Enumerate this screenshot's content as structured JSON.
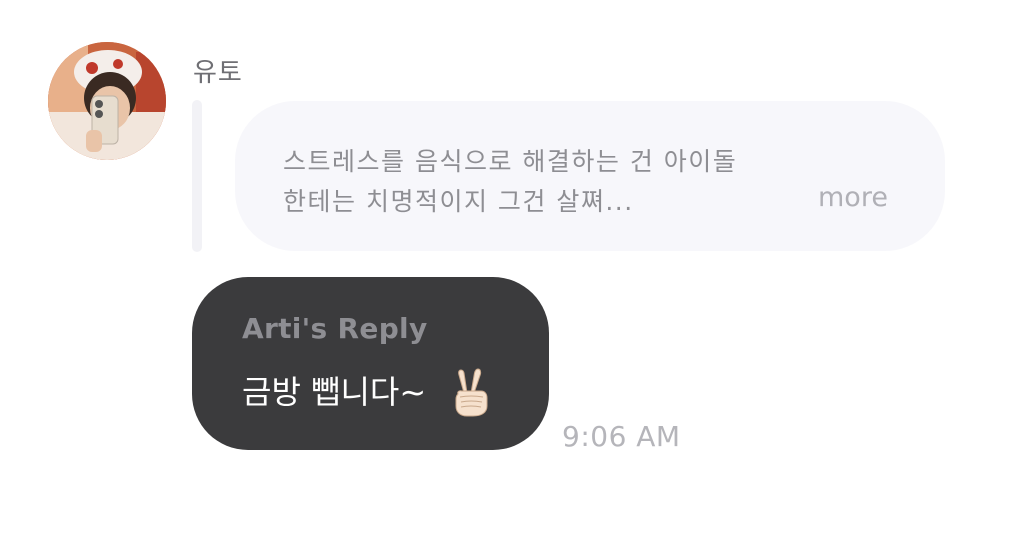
{
  "message": {
    "sender_name": "유토",
    "avatar_icon": "profile-photo",
    "quoted": {
      "line1": "스트레스를 음식으로 해결하는 건 아이돌",
      "line2": "한테는 치명적이지 그건 살쪄...",
      "more_label": "more"
    },
    "reply": {
      "title": "Arti's Reply",
      "text": "금방 뺍니다~",
      "emoji": "✌🏻"
    },
    "timestamp": "9:06 AM"
  },
  "colors": {
    "quoted_bubble": "#f7f7fb",
    "reply_bubble": "#3b3b3d",
    "muted_text": "#8e8e93"
  }
}
